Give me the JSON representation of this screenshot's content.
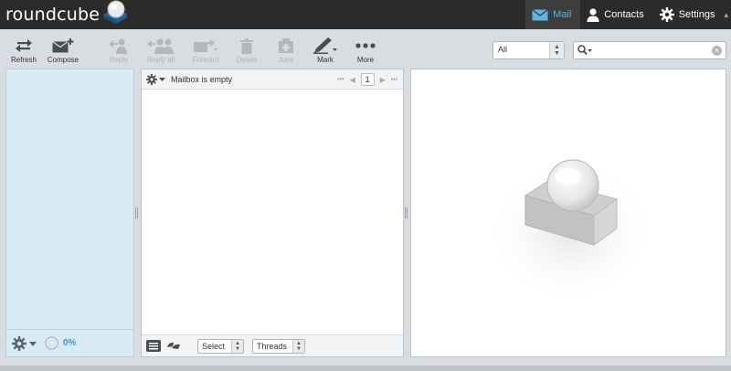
{
  "app": {
    "logo_text": "roundcube"
  },
  "topnav": {
    "mail": "Mail",
    "contacts": "Contacts",
    "settings": "Settings",
    "caret": "▴"
  },
  "toolbar": {
    "refresh": "Refresh",
    "compose": "Compose",
    "reply": "Reply",
    "reply_all": "Reply all",
    "forward": "Forward",
    "delete": "Delete",
    "junk": "Junk",
    "mark": "Mark",
    "more": "More"
  },
  "filter": {
    "selected": "All"
  },
  "search": {
    "placeholder": ""
  },
  "folders": {
    "quota": "0%"
  },
  "messagelist": {
    "status": "Mailbox is empty",
    "page": "1",
    "select_label": "Select",
    "threads_label": "Threads"
  },
  "colors": {
    "accent": "#5cb3e4",
    "topbar": "#2b2b2b",
    "folder_pane": "#d8ebf5"
  }
}
